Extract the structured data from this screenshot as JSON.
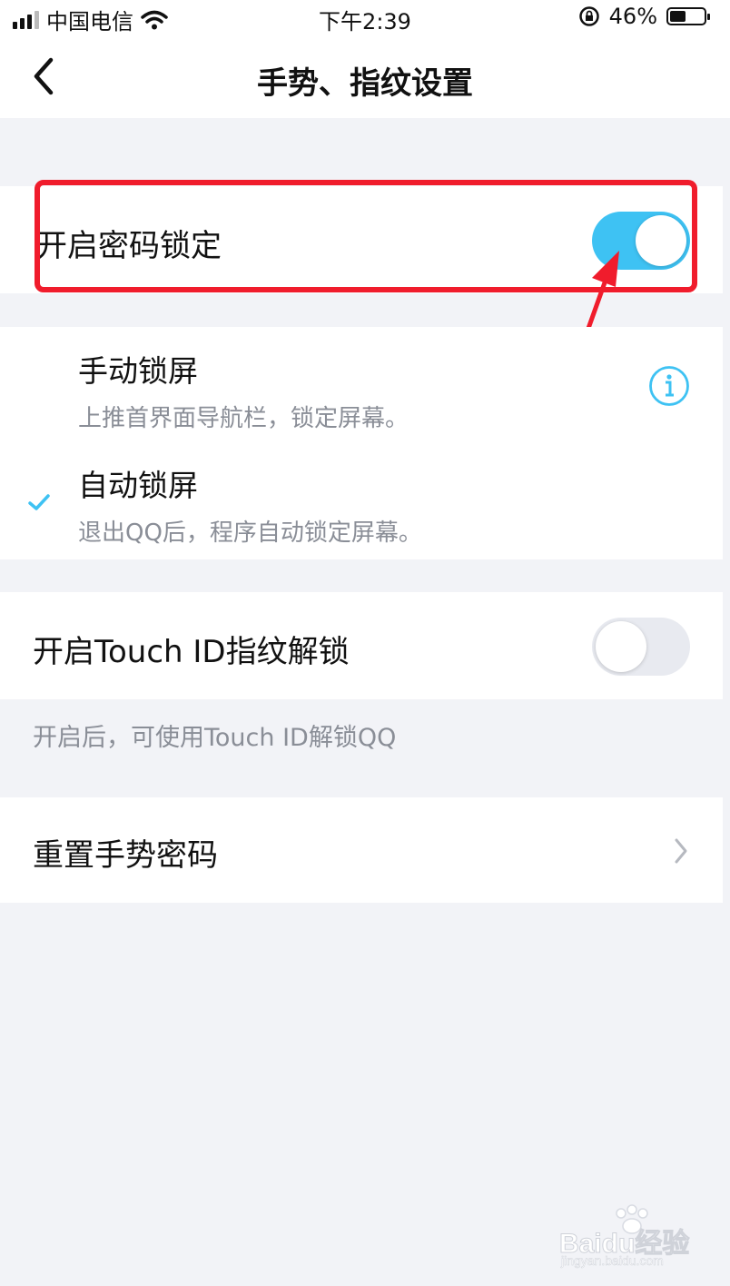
{
  "status_bar": {
    "carrier": "中国电信",
    "time": "下午2:39",
    "battery_percent_text": "46%",
    "battery_level": 0.46
  },
  "nav": {
    "title": "手势、指纹设置"
  },
  "lock_section": {
    "label": "开启密码锁定",
    "toggle_on": true
  },
  "lock_modes": {
    "manual": {
      "title": "手动锁屏",
      "subtitle": "上推首界面导航栏，锁定屏幕。"
    },
    "auto": {
      "title": "自动锁屏",
      "subtitle": "退出QQ后，程序自动锁定屏幕。",
      "selected": true
    }
  },
  "touch_id": {
    "label": "开启Touch ID指纹解锁",
    "toggle_on": false,
    "hint": "开启后，可使用Touch ID解锁QQ"
  },
  "reset": {
    "label": "重置手势密码"
  },
  "watermark": {
    "brand": "Baidu经验",
    "url": "jingyan.baidu.com"
  },
  "colors": {
    "accent": "#3ec2f3",
    "highlight": "#f01c2c",
    "background": "#f2f3f7"
  }
}
